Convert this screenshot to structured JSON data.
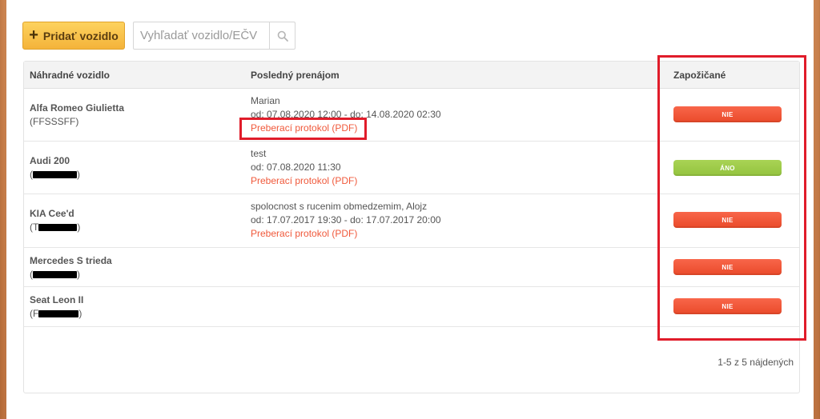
{
  "toolbar": {
    "add_button_label": "Pridať vozidlo",
    "search_placeholder": "Vyhľadať vozidlo/EČV"
  },
  "table": {
    "headers": {
      "vehicle": "Náhradné vozidlo",
      "last_rental": "Posledný prenájom",
      "borrowed": "Zapožičané"
    },
    "rows": [
      {
        "name": "Alfa Romeo Giulietta",
        "plate_open": "(FFSSSFF)",
        "rental_person": "Marian",
        "rental_dates": "od: 07.08.2020 12:00 - do: 14.08.2020 02:30",
        "rental_link": "Preberací protokol (PDF)",
        "status": "NIE",
        "status_color": "#ef5233"
      },
      {
        "name": "Audi 200",
        "plate_prefix": "(",
        "plate_suffix": ")",
        "rental_person": "test",
        "rental_dates": "od: 07.08.2020 11:30",
        "rental_link": "Preberací protokol (PDF)",
        "status": "ÁNO",
        "status_color": "#9dc94a"
      },
      {
        "name": "KIA Cee'd",
        "plate_prefix": "(T",
        "plate_suffix": ")",
        "rental_person": "spolocnost s rucenim obmedzemim, Alojz",
        "rental_dates": "od: 17.07.2017 19:30 - do: 17.07.2017 20:00",
        "rental_link": "Preberací protokol (PDF)",
        "status": "NIE",
        "status_color": "#ef5233"
      },
      {
        "name": "Mercedes S trieda",
        "plate_prefix": "(",
        "plate_suffix": ")",
        "status": "NIE",
        "status_color": "#ef5233"
      },
      {
        "name": "Seat Leon II",
        "plate_prefix": "(F",
        "plate_suffix": ")",
        "status": "NIE",
        "status_color": "#ef5233"
      }
    ]
  },
  "pager": {
    "summary": "1-5 z 5 nájdených"
  },
  "colors": {
    "accent": "#f4b33a",
    "link": "#f0593b",
    "highlight": "#e01c2a"
  }
}
